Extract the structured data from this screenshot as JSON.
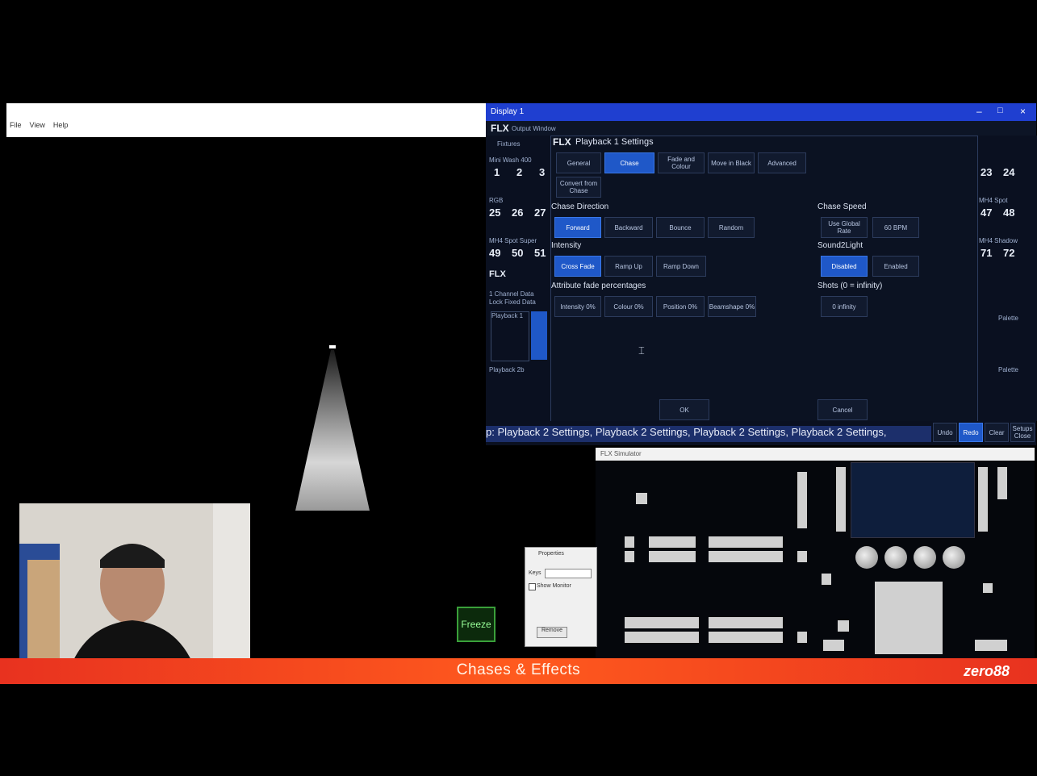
{
  "visualiser": {
    "freeze_label": "Freeze"
  },
  "flx": {
    "window_title": "Display 1",
    "header": "FLX",
    "header_sub": "Output Window",
    "side": {
      "fixtures_label": "Fixtures",
      "group1_label": "Mini Wash 400",
      "group1_nums": [
        "1",
        "2",
        "3"
      ],
      "group2_label": "RGB",
      "group2_nums": [
        "25",
        "26",
        "27"
      ],
      "group3_label": "MH4 Spot Super",
      "group3_nums": [
        "49",
        "50",
        "51"
      ],
      "lower_header": "FLX",
      "lower_line1": "1 Channel Data",
      "lower_line2": "Lock Fixed Data",
      "lower_item": "Playback 1",
      "lower_footer": "Playback 2b"
    },
    "right": {
      "nums_top": [
        "23",
        "24"
      ],
      "label_mid": "MH4 Spot",
      "nums_mid": [
        "47",
        "48"
      ],
      "label_low": "MH4 Shadow",
      "nums_low": [
        "71",
        "72"
      ],
      "btn1": "Palette",
      "btn2": "Palette"
    },
    "dialog": {
      "title": "Playback 1 Settings",
      "tabs": [
        "General",
        "Chase",
        "Fade and Colour",
        "Move in Black",
        "Advanced"
      ],
      "extra_tab": "Convert from Chase",
      "chase_direction_label": "Chase Direction",
      "direction_buttons": [
        "Forward",
        "Backward",
        "Bounce",
        "Random"
      ],
      "intensity_label": "Intensity",
      "intensity_buttons": [
        "Cross Fade",
        "Ramp Up",
        "Ramp Down"
      ],
      "attr_label": "Attribute fade percentages",
      "attr_buttons": [
        "Intensity 0%",
        "Colour 0%",
        "Position 0%",
        "Beamshape 0%"
      ],
      "chase_speed_label": "Chase Speed",
      "chase_speed_buttons": [
        "Use Global Rate",
        "60 BPM"
      ],
      "soundtolight_label": "Sound2Light",
      "soundtolight_buttons": [
        "Disabled",
        "Enabled"
      ],
      "shots_label": "Shots (0 = infinity)",
      "shots_button": "0 infinity",
      "ok_label": "OK",
      "cancel_label": "Cancel"
    },
    "ticker": "p: Playback 2 Settings, Playback 2 Settings, Playback 2 Settings, Playback 2 Settings,",
    "ticker_buttons": [
      "Undo",
      "Redo",
      "Clear",
      "Setups Close"
    ]
  },
  "console": {
    "window_title": "FLX Simulator"
  },
  "small_dialog": {
    "title": "Properties",
    "field_label": "Keys",
    "checkbox_label": "Show Monitor",
    "button_label": "Remove"
  },
  "banner": {
    "title": "Chases & Effects",
    "logo": "zero88"
  },
  "colors": {
    "banner": "#ff5a1e",
    "flx_title": "#1f3fd0",
    "active_button": "#1f58c8"
  }
}
